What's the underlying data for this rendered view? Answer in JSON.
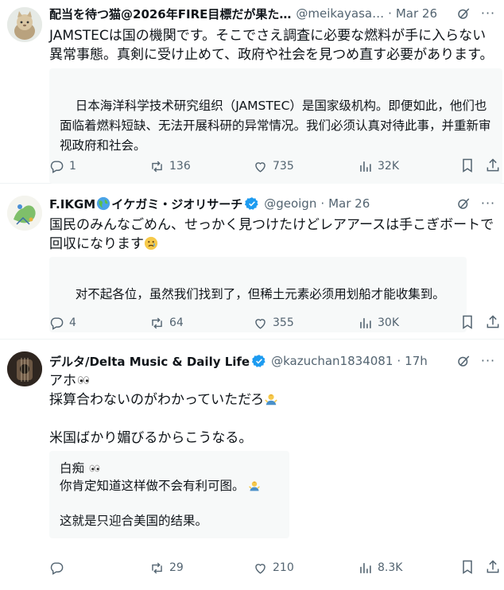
{
  "tweets": [
    {
      "name": "配当を待つ猫@2026年FIRE目標だが果た…",
      "handle": "@meikayasa…",
      "sep": "·",
      "date": "Mar 26",
      "text": "JAMSTECは国の機関です。そこでさえ調査に必要な燃料が手に入らない異常事態。真剣に受け止めて、政府や社会を見つめ直す必要があります。",
      "translation": "日本海洋科学技术研究组织（JAMSTEC）是国家级机构。即便如此，他们也面临着燃料短缺、无法开展科研的异常情况。我们必须认真对待此事，并重新审视政府和社会。",
      "replies": "1",
      "reposts": "136",
      "likes": "735",
      "views": "32K"
    },
    {
      "name_part1": "F.IKGM",
      "name_part2": "イケガミ・ジオリサーチ",
      "handle": "@geoign",
      "sep": "·",
      "date": "Mar 26",
      "text": "国民のみんなごめん、せっかく見つけたけどレアアースは手こぎボートで回収になります",
      "translation": "对不起各位，虽然我们找到了，但稀土元素必须用划船才能收集到。",
      "replies": "4",
      "reposts": "64",
      "likes": "355",
      "views": "30K"
    },
    {
      "name": "デルタ/Delta Music & Daily Life",
      "handle": "@kazuchan1834081",
      "sep": "·",
      "date": "17h",
      "text_line1": "アホ",
      "text_line2": "採算合わないのがわかっていただろ",
      "text_line3": "米国ばかり媚びるからこうなる。",
      "trans_line1": "白痴",
      "trans_line2": "你肯定知道这样做不会有利可图。",
      "trans_line3": "这就是只迎合美国的结果。",
      "replies": "",
      "reposts": "29",
      "likes": "210",
      "views": "8.3K"
    }
  ],
  "icons": {
    "reply": "reply-icon",
    "repost": "repost-icon",
    "like": "like-icon",
    "views": "views-icon",
    "bookmark": "bookmark-icon",
    "share": "share-icon",
    "grok": "grok-icon",
    "more": "more-icon",
    "verified": "verified-badge-icon"
  },
  "colors": {
    "text": "#0f1419",
    "secondary": "#536471",
    "verified": "#1d9bf0",
    "translation_bg": "#f7f9f9"
  },
  "more_glyph": "···"
}
